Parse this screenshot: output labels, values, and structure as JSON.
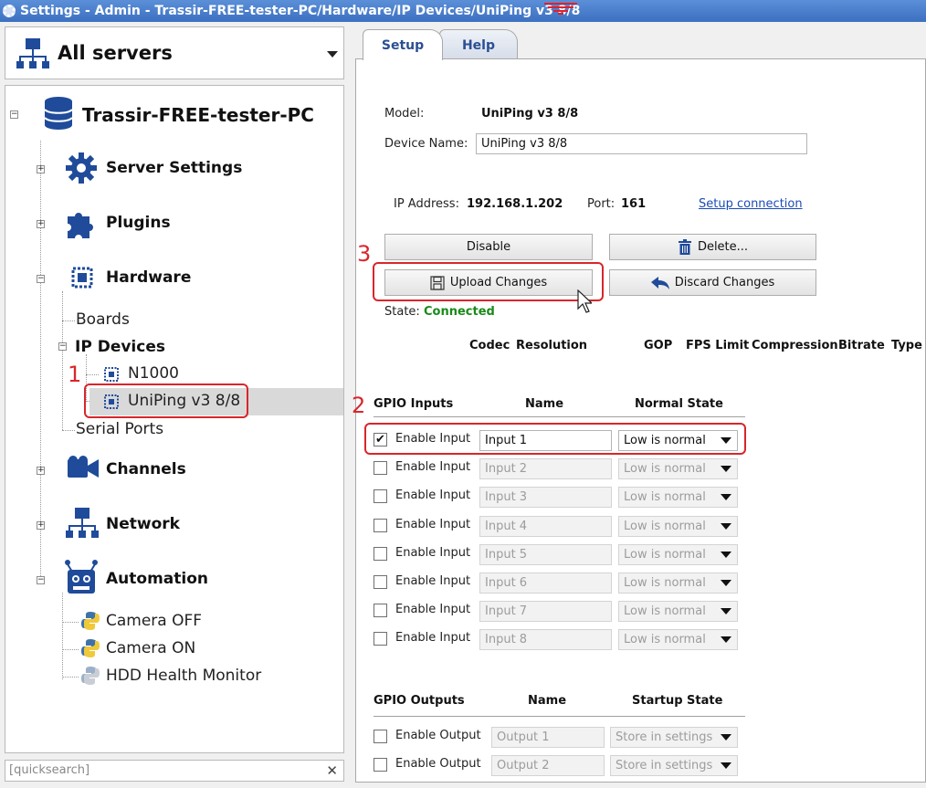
{
  "window": {
    "title": "Settings - Admin - Trassir-FREE-tester-PC/Hardware/IP Devices/UniPing v3 8/8"
  },
  "servers_dropdown": {
    "label": "All servers",
    "icon": "server-network-icon"
  },
  "tree": {
    "root": "Trassir-FREE-tester-PC",
    "items": [
      {
        "label": "Server Settings",
        "icon": "gear-icon"
      },
      {
        "label": "Plugins",
        "icon": "puzzle-icon"
      },
      {
        "label": "Hardware",
        "icon": "chip-icon"
      },
      {
        "label": "Channels",
        "icon": "camera-icon"
      },
      {
        "label": "Network",
        "icon": "network-icon"
      },
      {
        "label": "Automation",
        "icon": "robot-icon"
      }
    ],
    "hardware_children": {
      "boards": "Boards",
      "ip_devices": "IP Devices",
      "n1000": "N1000",
      "uniping": "UniPing v3 8/8",
      "serial_ports": "Serial Ports"
    },
    "automation_children": [
      "Camera OFF",
      "Camera ON",
      "HDD Health Monitor"
    ]
  },
  "annotations": {
    "one": "1",
    "two": "2",
    "three": "3"
  },
  "search": {
    "placeholder": "[quicksearch]"
  },
  "tabs": [
    "Setup",
    "Help"
  ],
  "device": {
    "model_label": "Model:",
    "model_value": "UniPing v3 8/8",
    "name_label": "Device Name:",
    "name_value": "UniPing v3 8/8",
    "ip_label": "IP Address:",
    "ip_value": "192.168.1.202",
    "port_label": "Port:",
    "port_value": "161",
    "setup_link": "Setup connection",
    "state_label": "State:",
    "state_value": "Connected",
    "state_color": "#1a8a1a"
  },
  "buttons": {
    "disable": "Disable",
    "delete": "Delete...",
    "upload": "Upload Changes",
    "discard": "Discard Changes"
  },
  "stream_headers": [
    "Codec",
    "Resolution",
    "GOP",
    "FPS Limit",
    "Compression",
    "Bitrate",
    "Type"
  ],
  "gpio_inputs": {
    "headers": [
      "GPIO Inputs",
      "Name",
      "Normal State"
    ],
    "rows": [
      {
        "label": "Enable Input",
        "name": "Input 1",
        "state": "Low is normal",
        "checked": true
      },
      {
        "label": "Enable Input",
        "name": "Input 2",
        "state": "Low is normal",
        "checked": false
      },
      {
        "label": "Enable Input",
        "name": "Input 3",
        "state": "Low is normal",
        "checked": false
      },
      {
        "label": "Enable Input",
        "name": "Input 4",
        "state": "Low is normal",
        "checked": false
      },
      {
        "label": "Enable Input",
        "name": "Input 5",
        "state": "Low is normal",
        "checked": false
      },
      {
        "label": "Enable Input",
        "name": "Input 6",
        "state": "Low is normal",
        "checked": false
      },
      {
        "label": "Enable Input",
        "name": "Input 7",
        "state": "Low is normal",
        "checked": false
      },
      {
        "label": "Enable Input",
        "name": "Input 8",
        "state": "Low is normal",
        "checked": false
      }
    ]
  },
  "gpio_outputs": {
    "headers": [
      "GPIO Outputs",
      "Name",
      "Startup State"
    ],
    "rows": [
      {
        "label": "Enable Output",
        "name": "Output 1",
        "state": "Store in settings",
        "checked": false
      },
      {
        "label": "Enable Output",
        "name": "Output 2",
        "state": "Store in settings",
        "checked": false
      }
    ]
  },
  "colors": {
    "annotation": "#d9262b",
    "link": "#1b4bb3",
    "icon_blue": "#1f4b9a"
  }
}
